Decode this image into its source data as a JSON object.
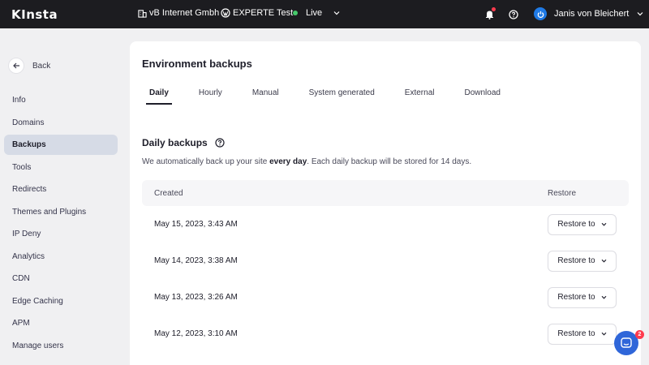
{
  "topbar": {
    "logo": "KInsta",
    "company": "vB Internet Gmbh",
    "site": "EXPERTE Test",
    "environment": "Live",
    "environment_color": "#46c96b",
    "user": "Janis von Bleichert"
  },
  "sidebar": {
    "back_label": "Back",
    "items": [
      {
        "label": "Info",
        "active": false
      },
      {
        "label": "Domains",
        "active": false
      },
      {
        "label": "Backups",
        "active": true
      },
      {
        "label": "Tools",
        "active": false
      },
      {
        "label": "Redirects",
        "active": false
      },
      {
        "label": "Themes and Plugins",
        "active": false
      },
      {
        "label": "IP Deny",
        "active": false
      },
      {
        "label": "Analytics",
        "active": false
      },
      {
        "label": "CDN",
        "active": false
      },
      {
        "label": "Edge Caching",
        "active": false
      },
      {
        "label": "APM",
        "active": false
      },
      {
        "label": "Manage users",
        "active": false
      }
    ]
  },
  "main": {
    "title": "Environment backups",
    "tabs": [
      {
        "label": "Daily",
        "active": true
      },
      {
        "label": "Hourly",
        "active": false
      },
      {
        "label": "Manual",
        "active": false
      },
      {
        "label": "System generated",
        "active": false
      },
      {
        "label": "External",
        "active": false
      },
      {
        "label": "Download",
        "active": false
      }
    ],
    "section_title": "Daily backups",
    "desc_prefix": "We automatically back up your site ",
    "desc_bold": "every day",
    "desc_suffix": ". Each daily backup will be stored for 14 days.",
    "table": {
      "col_created": "Created",
      "col_restore": "Restore",
      "restore_button": "Restore to",
      "rows": [
        "May 15, 2023, 3:43 AM",
        "May 14, 2023, 3:38 AM",
        "May 13, 2023, 3:26 AM",
        "May 12, 2023, 3:10 AM"
      ]
    }
  },
  "chat": {
    "badge": "2"
  }
}
